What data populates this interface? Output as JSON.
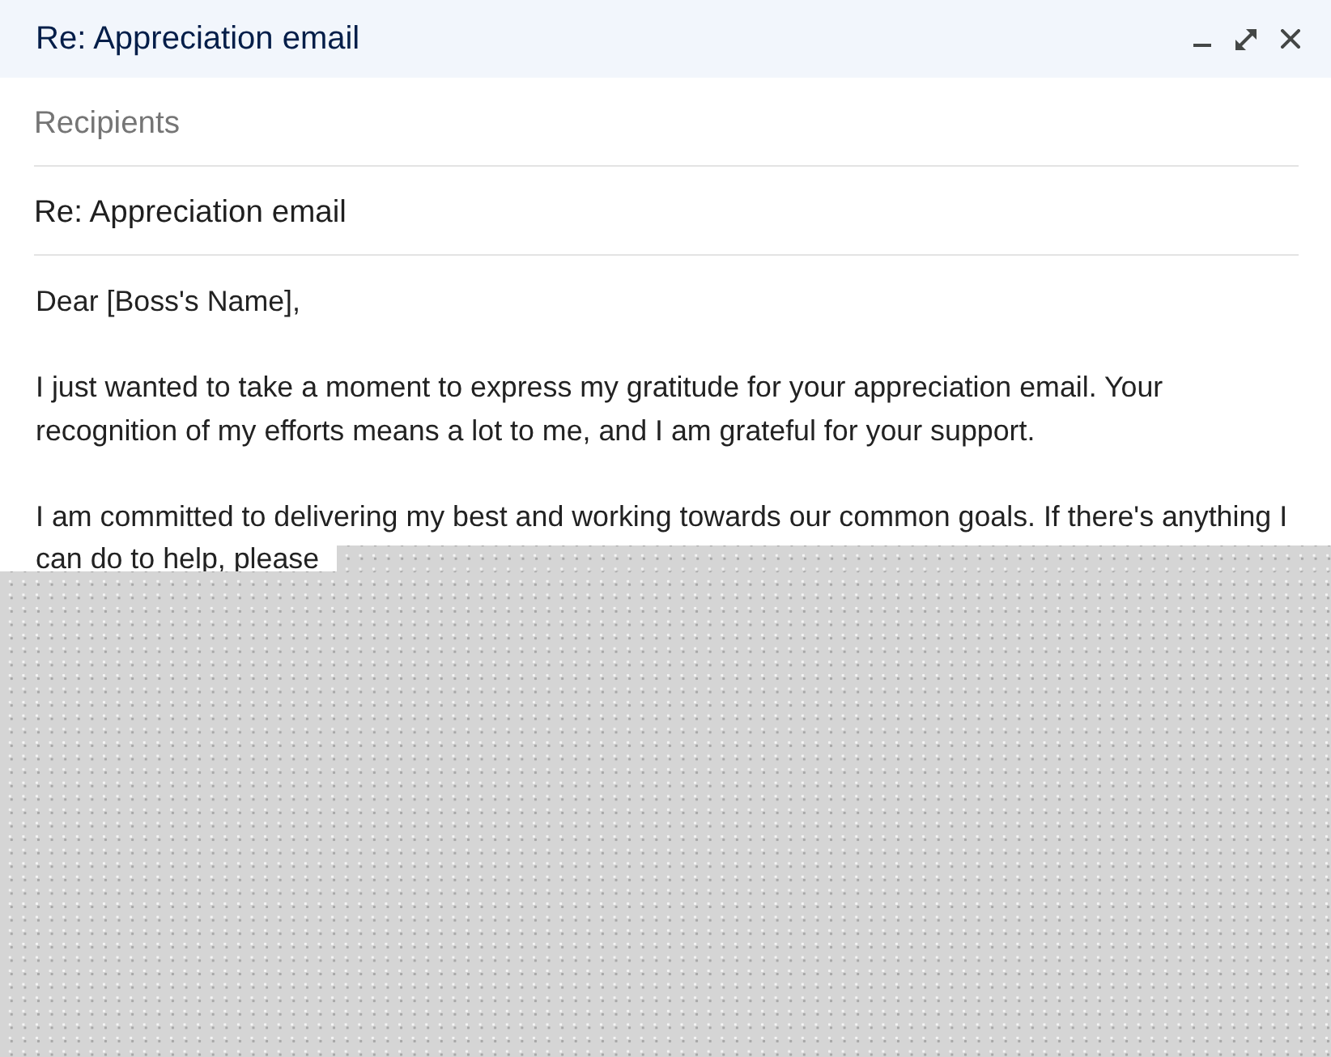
{
  "window": {
    "title": "Re: Appreciation email"
  },
  "recipients": {
    "placeholder": "Recipients"
  },
  "subject": {
    "value": "Re: Appreciation email"
  },
  "body": {
    "paragraphs": [
      "Dear [Boss's Name],",
      "I just wanted to take a moment to express my gratitude for your appreciation email. Your recognition of my efforts means a lot to me, and I am grateful for your support.",
      "I am committed to delivering my best and working towards our common goals. If there's anything I can do to help, please"
    ]
  }
}
